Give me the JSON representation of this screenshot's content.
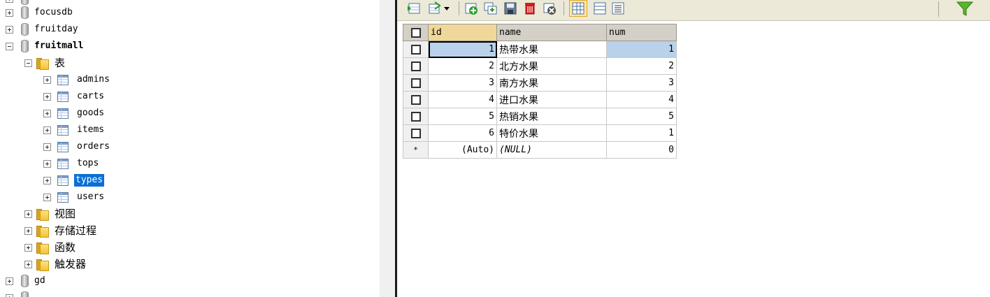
{
  "tree": {
    "databases": [
      {
        "name": "focusdb"
      },
      {
        "name": "fruitday"
      },
      {
        "name": "fruitmall"
      },
      {
        "name": "gd"
      }
    ],
    "fruitmall_children": {
      "tables_folder": "表",
      "tables": [
        "admins",
        "carts",
        "goods",
        "items",
        "orders",
        "tops",
        "types",
        "users"
      ],
      "selected_table": "types",
      "folders": [
        "视图",
        "存储过程",
        "函数",
        "触发器"
      ]
    }
  },
  "toolbar": {
    "icons": [
      "insert-row-icon",
      "import-dropdown-icon",
      "add-record-icon",
      "duplicate-row-icon",
      "save-icon",
      "delete-icon",
      "refresh-icon",
      "grid-view-icon",
      "form-view-icon",
      "text-view-icon",
      "filter-icon"
    ]
  },
  "grid": {
    "columns": [
      "id",
      "name",
      "num"
    ],
    "rows": [
      {
        "id": "1",
        "name": "热带水果",
        "num": "1"
      },
      {
        "id": "2",
        "name": "北方水果",
        "num": "2"
      },
      {
        "id": "3",
        "name": "南方水果",
        "num": "3"
      },
      {
        "id": "4",
        "name": "进口水果",
        "num": "4"
      },
      {
        "id": "5",
        "name": "热销水果",
        "num": "5"
      },
      {
        "id": "6",
        "name": "特价水果",
        "num": "1"
      }
    ],
    "new_row": {
      "marker": "*",
      "id": "(Auto)",
      "name": "(NULL)",
      "num": "0"
    }
  },
  "colors": {
    "selection": "#0a6fd6",
    "row_highlight": "#b9d1ea",
    "header_bg": "#d4d0c8",
    "id_header_bg": "#f0d79a"
  }
}
